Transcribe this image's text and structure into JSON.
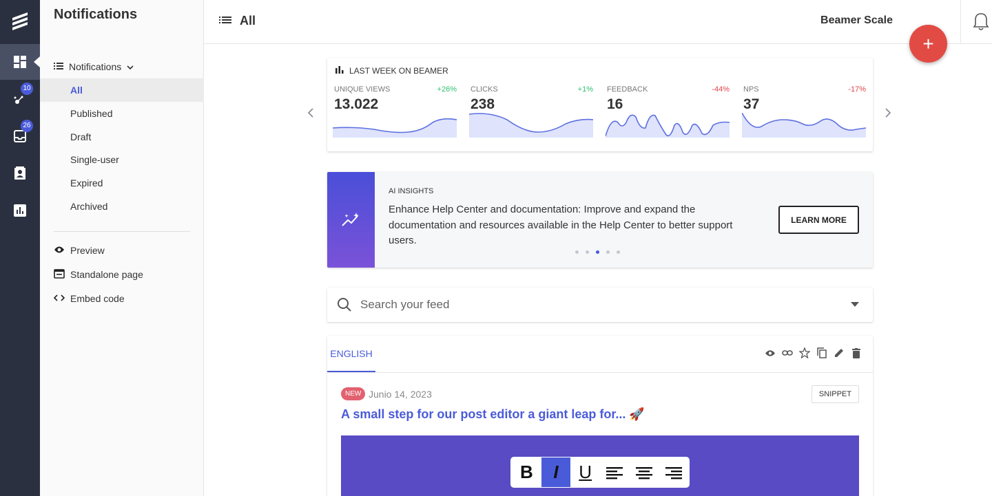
{
  "rail": {
    "badges": {
      "campaigns": "10",
      "inbox": "26"
    }
  },
  "sidebar": {
    "title": "Notifications",
    "group_label": "Notifications",
    "items": [
      {
        "label": "All",
        "active": true
      },
      {
        "label": "Published"
      },
      {
        "label": "Draft"
      },
      {
        "label": "Single-user"
      },
      {
        "label": "Expired"
      },
      {
        "label": "Archived"
      }
    ],
    "links": [
      {
        "label": "Preview",
        "icon": "eye-icon"
      },
      {
        "label": "Standalone page",
        "icon": "window-icon"
      },
      {
        "label": "Embed code",
        "icon": "code-icon"
      }
    ]
  },
  "header": {
    "title": "All",
    "brand": "Beamer Scale",
    "fab_label": "+"
  },
  "stats": {
    "title": "LAST WEEK ON BEAMER",
    "cards": [
      {
        "label": "UNIQUE VIEWS",
        "delta": "+26%",
        "value": "13.022",
        "trend": "up"
      },
      {
        "label": "CLICKS",
        "delta": "+1%",
        "value": "238",
        "trend": "up"
      },
      {
        "label": "FEEDBACK",
        "delta": "-44%",
        "value": "16",
        "trend": "down"
      },
      {
        "label": "NPS",
        "delta": "-17%",
        "value": "37",
        "trend": "down"
      }
    ],
    "colors": {
      "up": "#2fbf71",
      "down": "#e0444c",
      "line": "#5b6fe0",
      "fill": "#dfe3fb"
    }
  },
  "ai": {
    "kicker": "AI INSIGHTS",
    "text": "Enhance Help Center and documentation: Improve and expand the documentation and resources available in the Help Center to better support users.",
    "button": "LEARN MORE",
    "dots_total": 5,
    "dots_active": 3
  },
  "search": {
    "placeholder": "Search your feed"
  },
  "post": {
    "tab": "ENGLISH",
    "badge": "NEW",
    "date": "Junio 14, 2023",
    "tag": "SNIPPET",
    "title": "A small step for our post editor a giant leap for... 🚀",
    "toolbar": [
      "B",
      "I",
      "U"
    ]
  }
}
